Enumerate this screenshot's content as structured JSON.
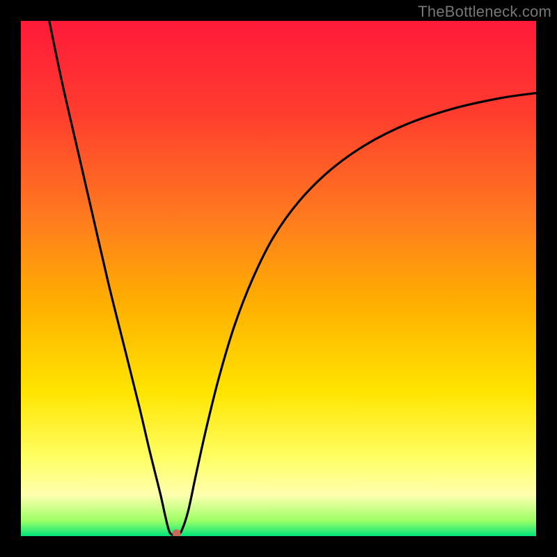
{
  "watermark": "TheBottleneck.com",
  "chart_data": {
    "type": "line",
    "title": "",
    "xlabel": "",
    "ylabel": "",
    "xlim": [
      0,
      100
    ],
    "ylim": [
      0,
      100
    ],
    "background_gradient": {
      "stops": [
        {
          "offset": 0.0,
          "color": "#ff1a3a"
        },
        {
          "offset": 0.18,
          "color": "#ff3d2e"
        },
        {
          "offset": 0.38,
          "color": "#ff7a1f"
        },
        {
          "offset": 0.55,
          "color": "#ffb000"
        },
        {
          "offset": 0.72,
          "color": "#ffe500"
        },
        {
          "offset": 0.85,
          "color": "#ffff66"
        },
        {
          "offset": 0.92,
          "color": "#ffffb0"
        },
        {
          "offset": 0.97,
          "color": "#9cff66"
        },
        {
          "offset": 1.0,
          "color": "#00e57a"
        }
      ]
    },
    "curve": {
      "comment": "V-shaped score curve; minimum near x≈29, y≈0; left arm steep, right arm asymptotic",
      "points": [
        {
          "x": 5.5,
          "y": 100.0
        },
        {
          "x": 8.0,
          "y": 88.0
        },
        {
          "x": 11.0,
          "y": 75.0
        },
        {
          "x": 14.0,
          "y": 62.0
        },
        {
          "x": 17.0,
          "y": 49.0
        },
        {
          "x": 20.0,
          "y": 37.0
        },
        {
          "x": 23.0,
          "y": 25.0
        },
        {
          "x": 25.0,
          "y": 16.5
        },
        {
          "x": 27.0,
          "y": 8.5
        },
        {
          "x": 28.0,
          "y": 4.0
        },
        {
          "x": 28.7,
          "y": 1.2
        },
        {
          "x": 29.3,
          "y": 0.3
        },
        {
          "x": 30.5,
          "y": 0.3
        },
        {
          "x": 31.3,
          "y": 1.3
        },
        {
          "x": 32.5,
          "y": 5.0
        },
        {
          "x": 34.0,
          "y": 12.0
        },
        {
          "x": 36.0,
          "y": 21.0
        },
        {
          "x": 38.5,
          "y": 31.0
        },
        {
          "x": 41.5,
          "y": 41.0
        },
        {
          "x": 45.0,
          "y": 50.0
        },
        {
          "x": 49.0,
          "y": 58.0
        },
        {
          "x": 54.0,
          "y": 65.0
        },
        {
          "x": 60.0,
          "y": 71.0
        },
        {
          "x": 67.0,
          "y": 76.0
        },
        {
          "x": 75.0,
          "y": 80.0
        },
        {
          "x": 84.0,
          "y": 83.0
        },
        {
          "x": 93.0,
          "y": 85.0
        },
        {
          "x": 100.0,
          "y": 86.0
        }
      ]
    },
    "marker": {
      "x": 30.2,
      "y": 0.5,
      "color": "#c86a5a",
      "radius": 6
    }
  }
}
